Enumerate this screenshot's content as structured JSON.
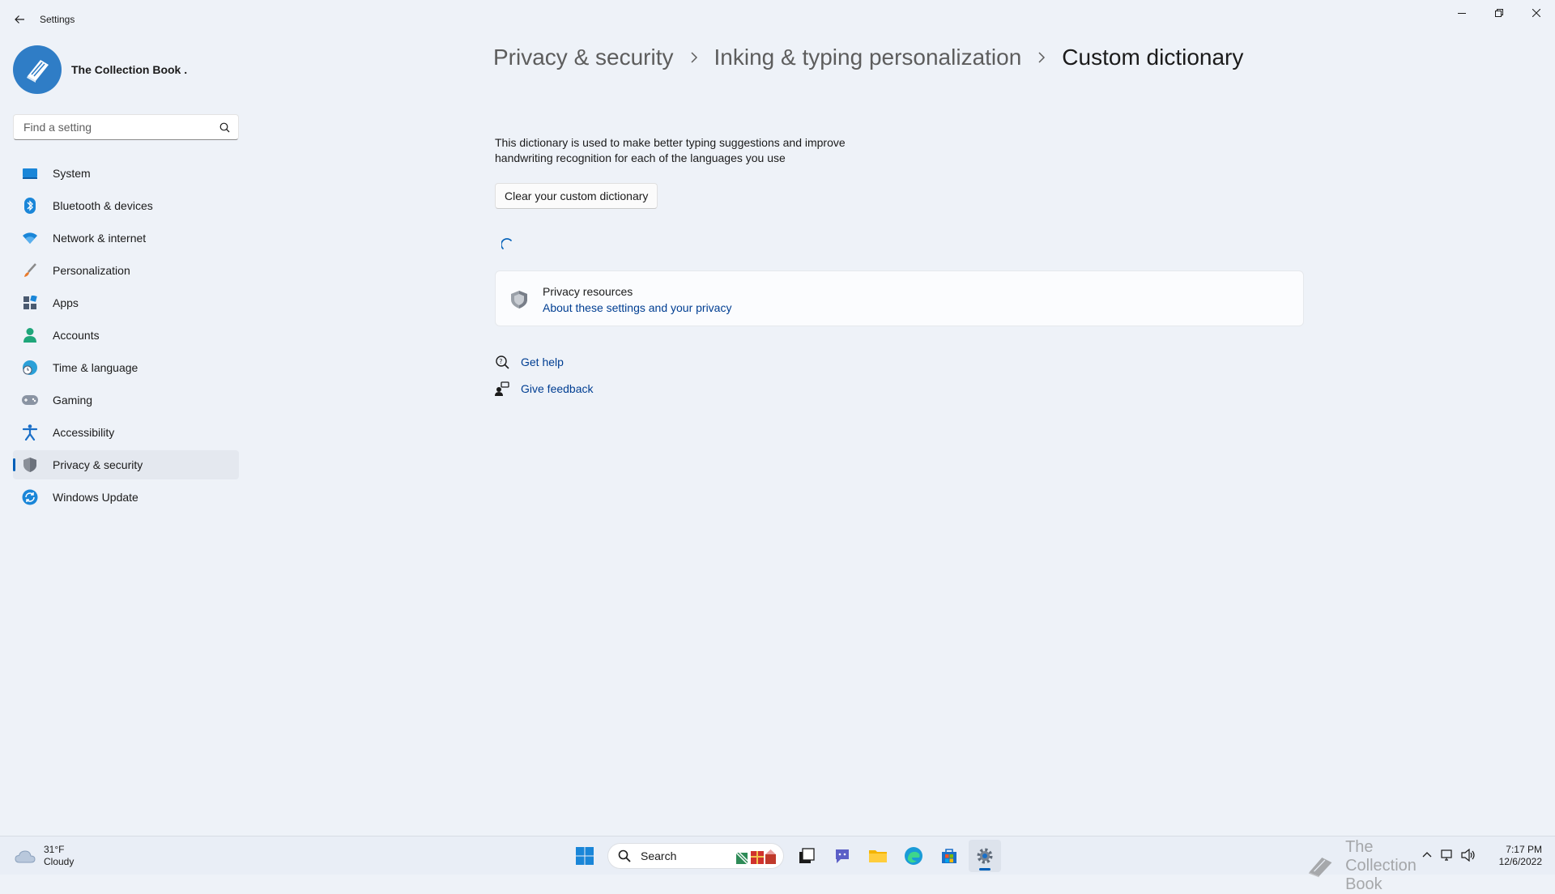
{
  "window": {
    "app_title": "Settings"
  },
  "profile": {
    "name": "The Collection Book ."
  },
  "search": {
    "placeholder": "Find a setting"
  },
  "sidebar": {
    "items": [
      {
        "label": "System",
        "icon": "system-icon"
      },
      {
        "label": "Bluetooth & devices",
        "icon": "bluetooth-icon"
      },
      {
        "label": "Network & internet",
        "icon": "wifi-icon"
      },
      {
        "label": "Personalization",
        "icon": "brush-icon"
      },
      {
        "label": "Apps",
        "icon": "apps-icon"
      },
      {
        "label": "Accounts",
        "icon": "person-icon"
      },
      {
        "label": "Time & language",
        "icon": "globe-clock-icon"
      },
      {
        "label": "Gaming",
        "icon": "gamepad-icon"
      },
      {
        "label": "Accessibility",
        "icon": "accessibility-icon"
      },
      {
        "label": "Privacy & security",
        "icon": "shield-icon",
        "active": true
      },
      {
        "label": "Windows Update",
        "icon": "update-icon"
      }
    ]
  },
  "breadcrumb": {
    "items": [
      "Privacy & security",
      "Inking & typing personalization",
      "Custom dictionary"
    ]
  },
  "main": {
    "description": "This dictionary is used to make better typing suggestions and improve handwriting recognition for each of the languages you use",
    "clear_button": "Clear your custom dictionary",
    "privacy_card": {
      "title": "Privacy resources",
      "link": "About these settings and your privacy"
    },
    "help_links": [
      {
        "label": "Get help",
        "icon": "help-icon"
      },
      {
        "label": "Give feedback",
        "icon": "feedback-icon"
      }
    ]
  },
  "taskbar": {
    "weather": {
      "temp": "31°F",
      "condition": "Cloudy"
    },
    "search_label": "Search",
    "watermark": "The Collection Book",
    "clock": {
      "time": "7:17 PM",
      "date": "12/6/2022"
    }
  },
  "colors": {
    "accent": "#005fb8",
    "link": "#003e92",
    "background": "#eef2f8"
  }
}
